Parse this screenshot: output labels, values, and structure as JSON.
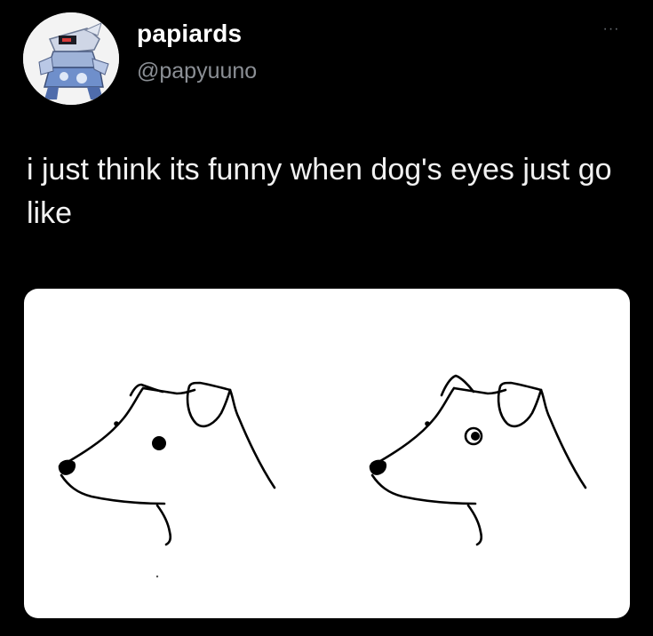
{
  "tweet": {
    "author": {
      "display_name": "papiards",
      "handle": "@papyuuno",
      "avatar_icon": "robot-figure-avatar"
    },
    "more_icon": "ellipsis-icon",
    "more_label": "···",
    "text": "i just think its funny when dog's eyes just go like",
    "media": {
      "description_icons": [
        "dog-drawing-normal-eye",
        "dog-drawing-ringed-eye"
      ]
    }
  },
  "colors": {
    "background": "#000000",
    "primary_text": "#ffffff",
    "secondary_text": "#8b8f95",
    "media_background": "#ffffff",
    "drawing_stroke": "#000000"
  }
}
